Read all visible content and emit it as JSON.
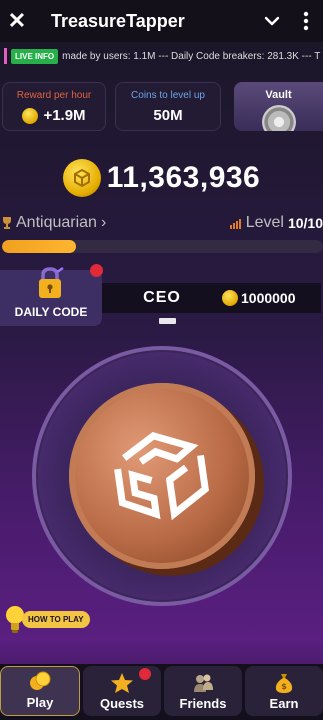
{
  "app": {
    "title": "TreasureTapper",
    "close_glyph": "✕"
  },
  "ticker": {
    "badge": "LIVE INFO",
    "text": "made by users:  1.1M --- Daily Code breakers:  281.3K --- T"
  },
  "stats": {
    "reward": {
      "label": "Reward per hour",
      "value": "+1.9M",
      "label_color": "#e0633f"
    },
    "coins_to_level": {
      "label": "Coins to level up",
      "value": "50M",
      "label_color": "#6fa3e8"
    },
    "vault": {
      "label": "Vault"
    }
  },
  "balance": {
    "value": "11,363,936"
  },
  "rank": {
    "name": "Antiquarian",
    "chevron": "›"
  },
  "level": {
    "label": "Level",
    "value": "10/10"
  },
  "progress": {
    "fraction": 0.23
  },
  "daily_code": {
    "label": "DAILY CODE"
  },
  "ceo": {
    "name": "CEO",
    "prize": "1000000"
  },
  "how_to_play": {
    "label": "HOW TO PLAY"
  },
  "nav": {
    "tabs": [
      {
        "label": "Play",
        "icon": "coins-icon",
        "active": true
      },
      {
        "label": "Quests",
        "icon": "star-icon",
        "badge": true
      },
      {
        "label": "Friends",
        "icon": "friends-icon"
      },
      {
        "label": "Earn",
        "icon": "money-bag-icon"
      }
    ]
  },
  "colors": {
    "accent_gold": "#f0a020",
    "live_badge": "#27b04a",
    "notification": "#e02a3a"
  }
}
